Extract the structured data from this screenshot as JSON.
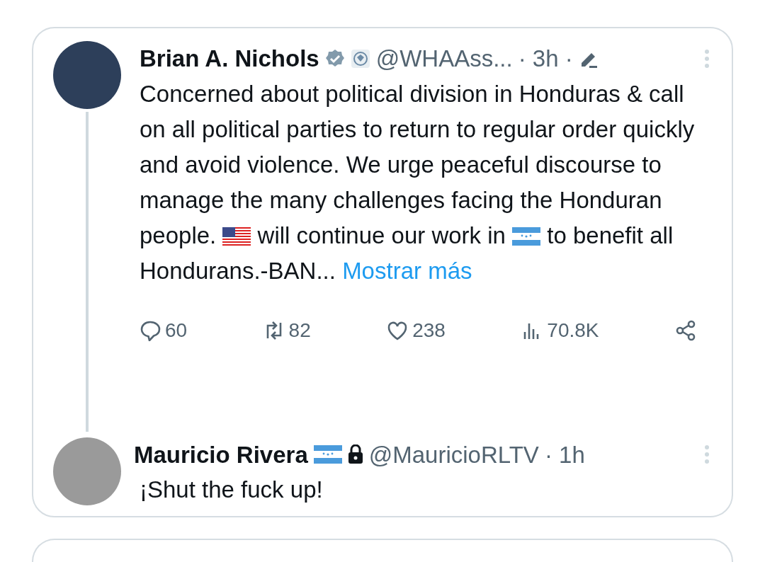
{
  "tweet": {
    "author": {
      "name": "Brian A. Nichols",
      "handle": "@WHAAss...",
      "time": "· 3h ·"
    },
    "text": [
      {
        "kind": "text",
        "text": "Concerned about political division in Honduras & call on all political parties to return to regular order quickly and avoid violence. We urge peaceful discourse to manage the many challenges facing the Honduran people. "
      },
      {
        "kind": "us_flag"
      },
      {
        "kind": "text",
        "text": " will continue our work in "
      },
      {
        "kind": "hn_flag"
      },
      {
        "kind": "text",
        "text": " to benefit all Hondurans.-BAN... "
      }
    ],
    "show_more": "Mostrar más",
    "actions": [
      {
        "kind": "reply",
        "count": "60"
      },
      {
        "kind": "repost",
        "count": "82"
      },
      {
        "kind": "like",
        "count": "238"
      },
      {
        "kind": "views",
        "count": "70.8K"
      },
      {
        "kind": "share"
      }
    ]
  },
  "reply": {
    "author": {
      "name": "Mauricio Rivera",
      "handle": "@MauricioRLTV",
      "time": "· 1h"
    },
    "text": "¡Shut the fuck up!"
  }
}
